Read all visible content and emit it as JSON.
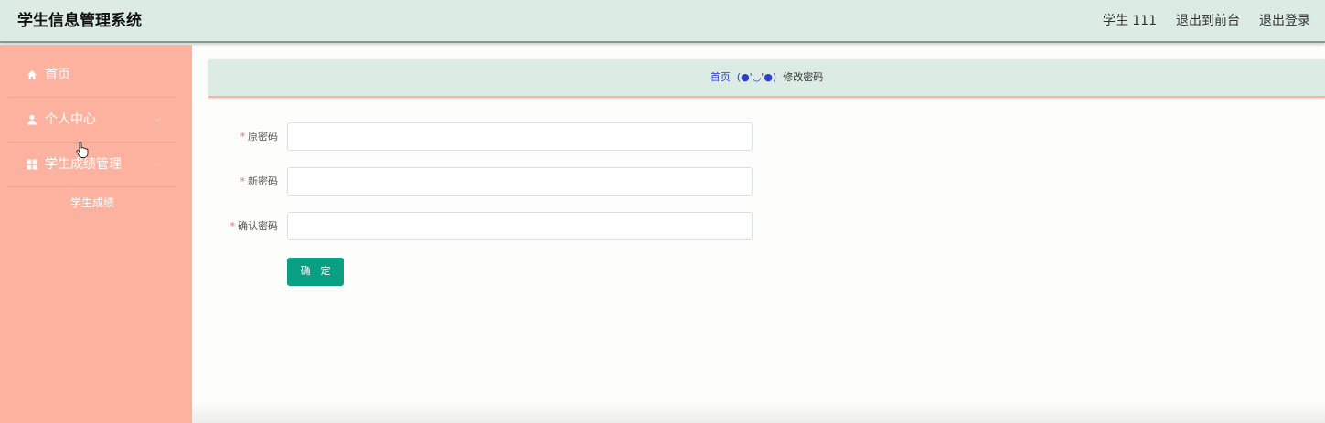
{
  "header": {
    "title": "学生信息管理系统",
    "user_label": "学生 111",
    "back_to_front": "退出到前台",
    "logout": "退出登录"
  },
  "sidebar": {
    "items": [
      {
        "label": "首页",
        "icon": "home-icon"
      },
      {
        "label": "个人中心",
        "icon": "user-icon"
      },
      {
        "label": "学生成绩管理",
        "icon": "grid-icon"
      }
    ],
    "sub_items": [
      {
        "label": "学生成绩"
      }
    ]
  },
  "breadcrumb": {
    "home": "首页",
    "separator": "(●'◡'●)",
    "current": "修改密码"
  },
  "form": {
    "fields": [
      {
        "label": "原密码",
        "required_mark": "*",
        "value": ""
      },
      {
        "label": "新密码",
        "required_mark": "*",
        "value": ""
      },
      {
        "label": "确认密码",
        "required_mark": "*",
        "value": ""
      }
    ],
    "submit_label": "确 定"
  },
  "colors": {
    "header_bg": "#dcebe4",
    "sidebar_bg": "#fdb29f",
    "accent_button": "#0a9e82",
    "breadcrumb_link": "#2f3fc8"
  }
}
